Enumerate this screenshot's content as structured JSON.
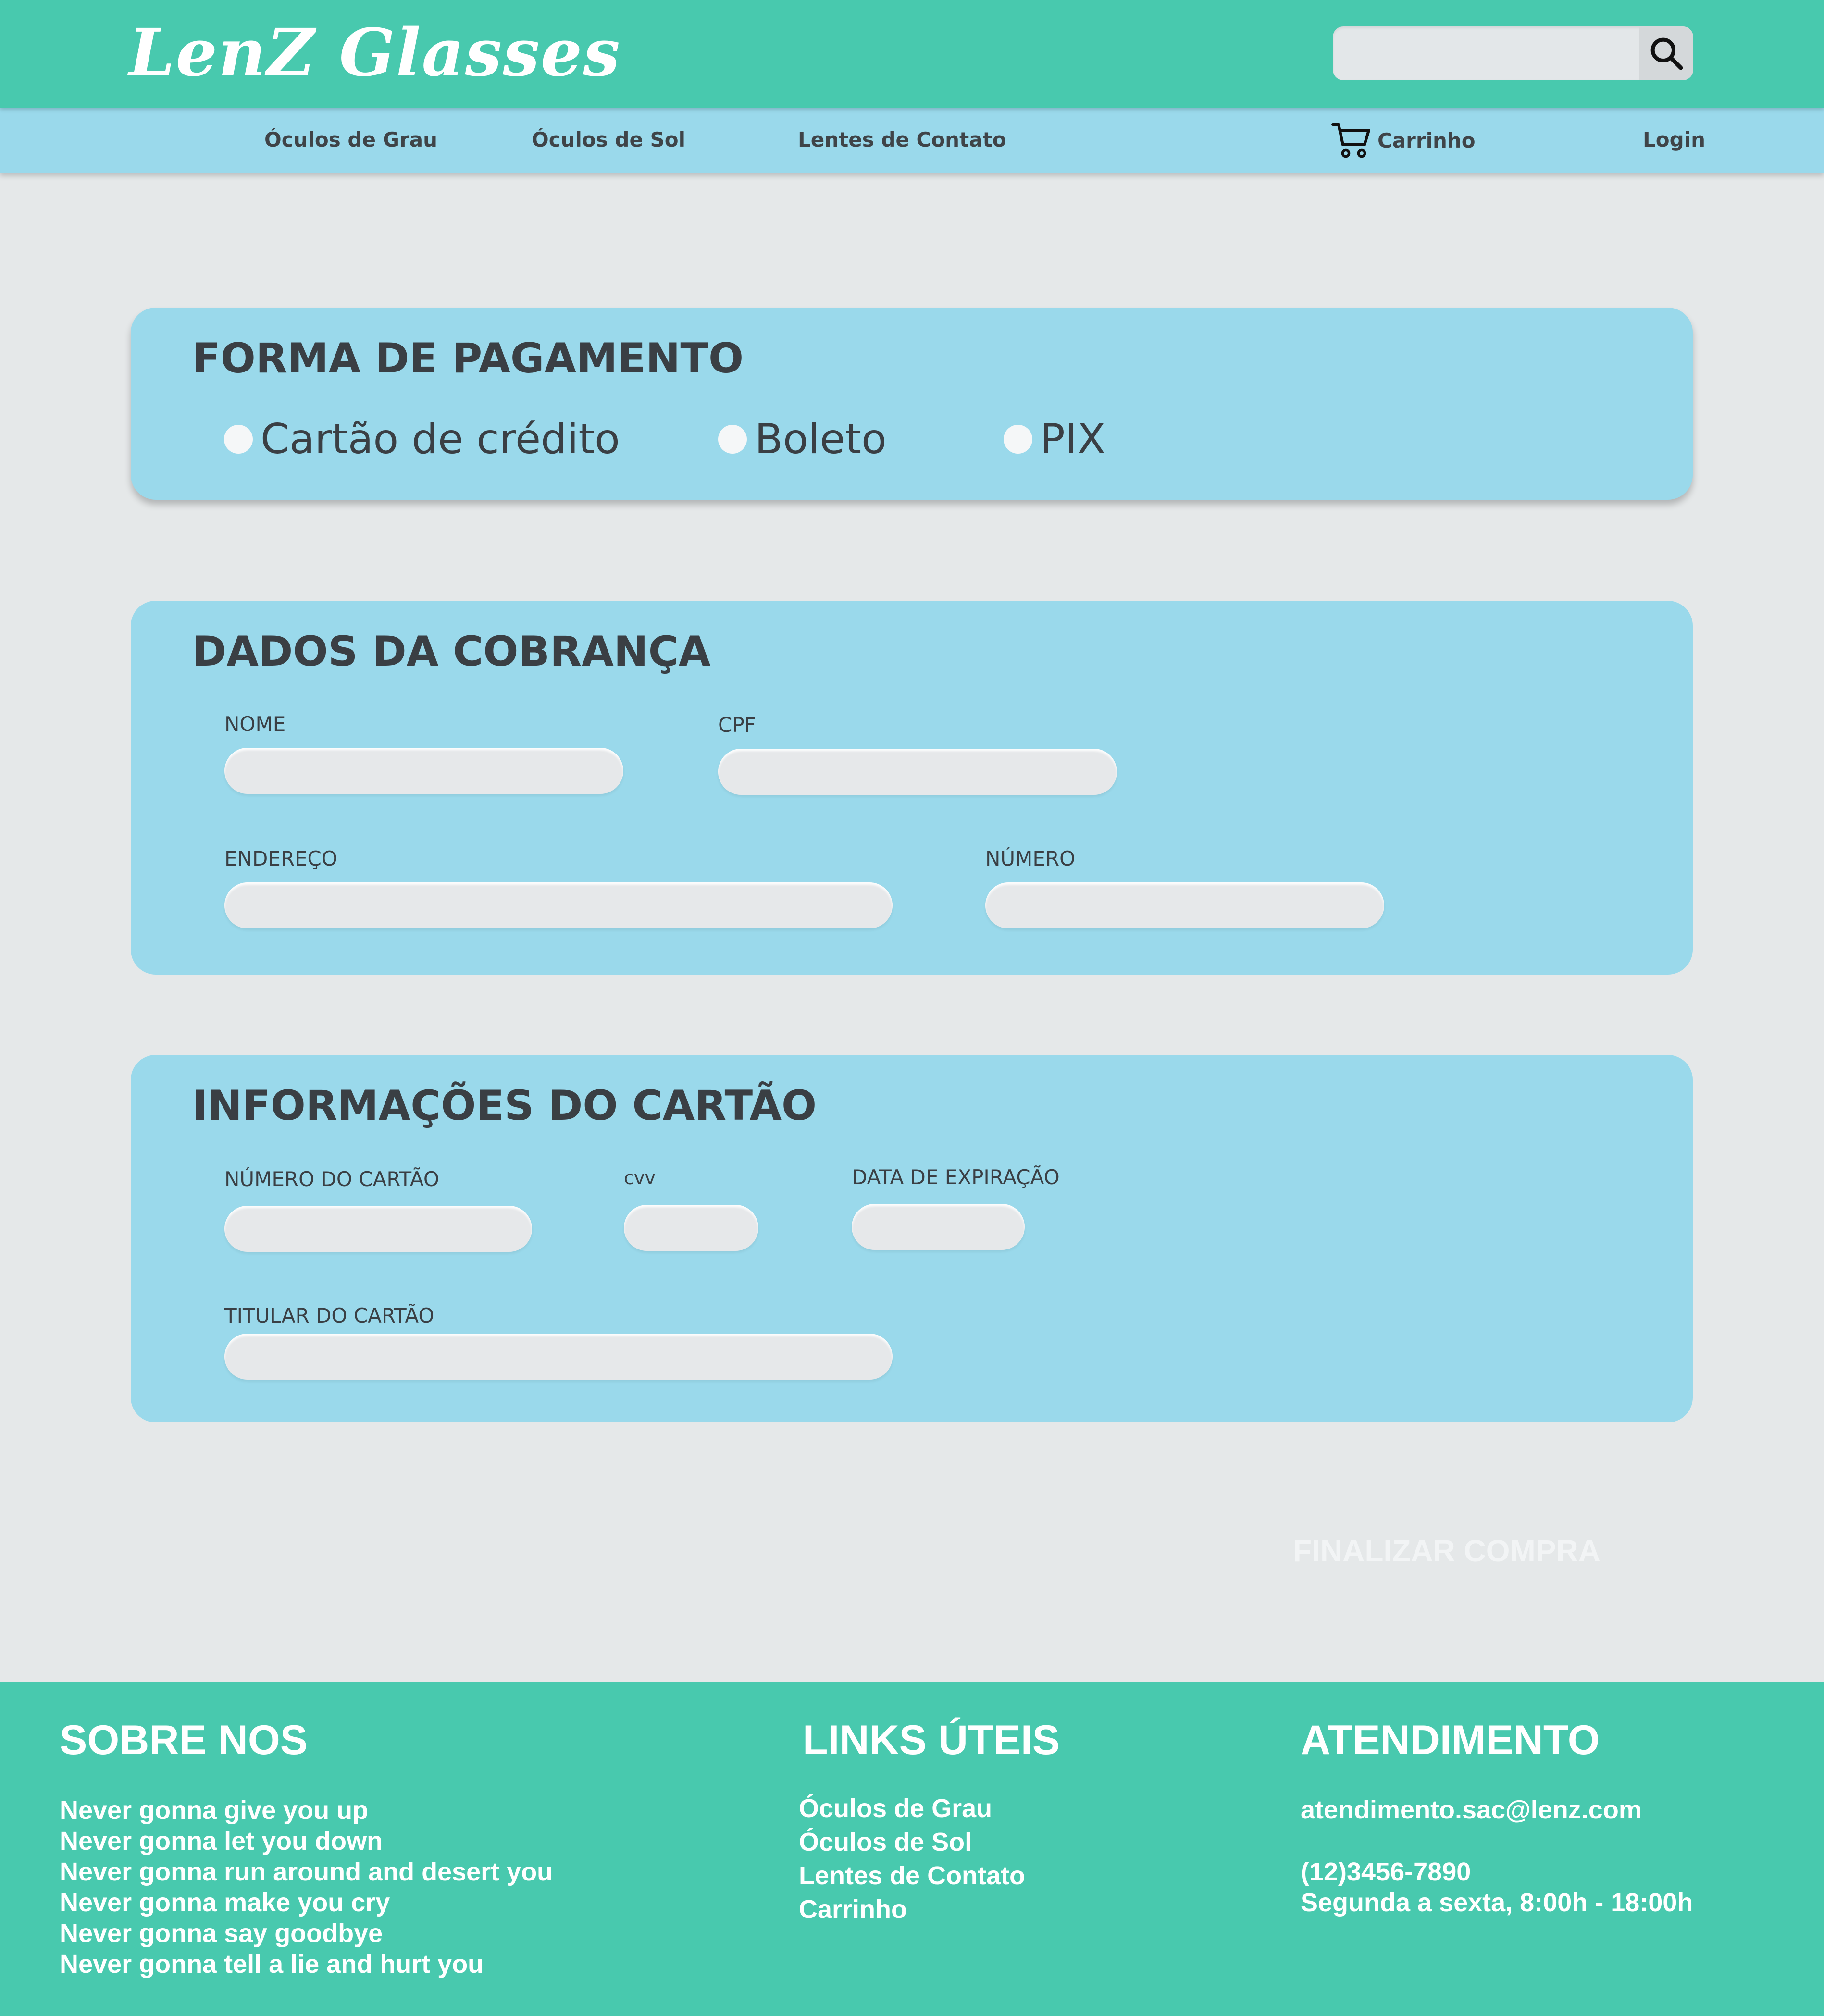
{
  "header": {
    "logo": "LenZ  Glasses",
    "search": {
      "placeholder": "",
      "button_icon": "search-icon"
    }
  },
  "nav": {
    "items": [
      "Óculos de Grau",
      "Óculos de Sol",
      "Lentes de Contato"
    ],
    "cart": {
      "label": "Carrinho",
      "icon": "cart-icon"
    },
    "login": "Login"
  },
  "payment": {
    "title": "FORMA DE PAGAMENTO",
    "options": [
      "Cartão de crédito",
      "Boleto",
      "PIX"
    ]
  },
  "billing": {
    "title": "DADOS DA COBRANÇA",
    "fields": {
      "nome": "NOME",
      "cpf": "CPF",
      "endereco": "ENDEREÇO",
      "numero": "NÚMERO"
    }
  },
  "card_info": {
    "title": "INFORMAÇÕES DO CARTÃO",
    "fields": {
      "numero_cartao": "NÚMERO DO CARTÃO",
      "cvv": "cvv",
      "data_expiracao": "DATA DE EXPIRAÇÃO",
      "titular": "TITULAR DO CARTÃO"
    }
  },
  "finalize_label": "FINALIZAR COMPRA",
  "footer": {
    "about": {
      "title": "SOBRE NOS",
      "lines": [
        "Never gonna give you up",
        "Never gonna let you down",
        "Never gonna run around and desert you",
        "Never gonna make you cry",
        "Never gonna say goodbye",
        "Never gonna tell a lie and hurt you"
      ]
    },
    "links": {
      "title": "LINKS ÚTEIS",
      "items": [
        "Óculos de Grau",
        "Óculos de Sol",
        "Lentes de Contato",
        "Carrinho"
      ]
    },
    "contact": {
      "title": "ATENDIMENTO",
      "email": "atendimento.sac@lenz.com",
      "phone": "(12)3456-7890",
      "hours": "Segunda a sexta, 8:00h - 18:00h"
    }
  },
  "colors": {
    "header_bg": "#48c9ae",
    "nav_bg": "#9ad9eb",
    "page_bg": "#e5e8e9",
    "card_bg": "#9ad9eb",
    "field_bg": "#e6e8ea",
    "footer_bg": "#48c9ae",
    "text_dark": "#3a3f44"
  }
}
